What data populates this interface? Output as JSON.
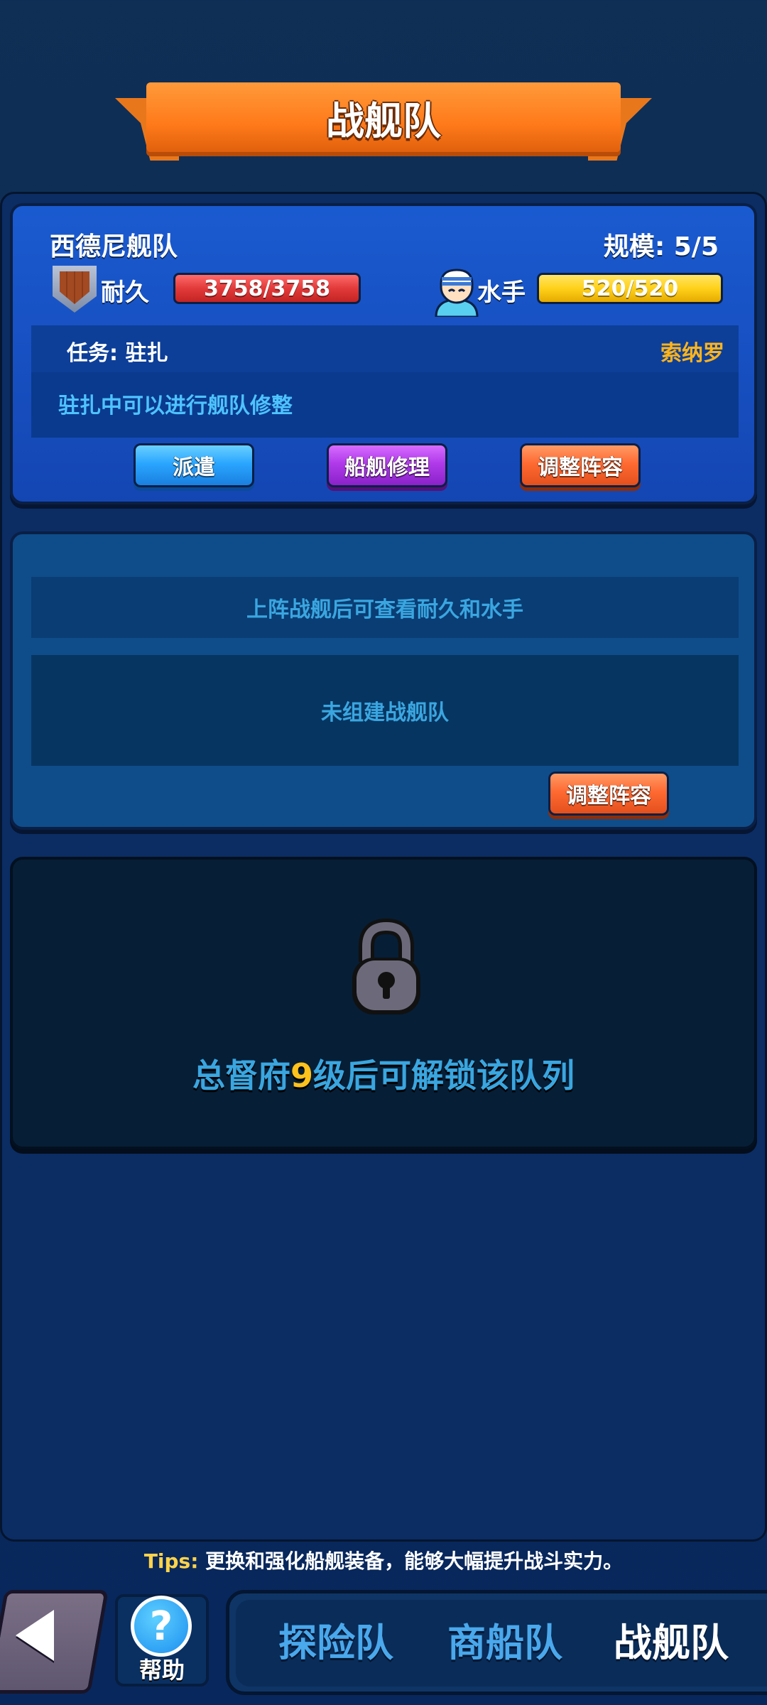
{
  "header": {
    "title": "战舰队"
  },
  "fleet1": {
    "name": "西德尼舰队",
    "scale": "规模: 5/5",
    "durability_label": "耐久",
    "durability_value": "3758/3758",
    "sailor_label": "水手",
    "sailor_value": "520/520",
    "mission": "任务: 驻扎",
    "location": "索纳罗",
    "mission_desc": "驻扎中可以进行舰队修整",
    "buttons": {
      "dispatch": "派遣",
      "repair": "船舰修理",
      "adjust": "调整阵容"
    }
  },
  "fleet2": {
    "info": "上阵战舰后可查看耐久和水手",
    "empty": "未组建战舰队",
    "adjust": "调整阵容"
  },
  "fleet3": {
    "unlock_prefix": "总督府",
    "unlock_level": "9",
    "unlock_suffix": "级后可解锁该队列"
  },
  "tips": {
    "key": "Tips:",
    "text": "更换和强化船舰装备，能够大幅提升战斗实力。"
  },
  "bottom_nav": {
    "help": "帮助",
    "tabs": [
      "探险队",
      "商船队",
      "战舰队"
    ],
    "active_tab": 2
  },
  "colors": {
    "accent_orange": "#ff7a1a",
    "durability_red": "#e23a3a",
    "sailor_yellow": "#ffd11a",
    "location_gold": "#ffb41c",
    "info_blue": "#3aa6e0"
  },
  "icons": [
    "shield-icon",
    "sailor-icon",
    "lock-icon",
    "back-arrow-icon",
    "help-icon"
  ]
}
